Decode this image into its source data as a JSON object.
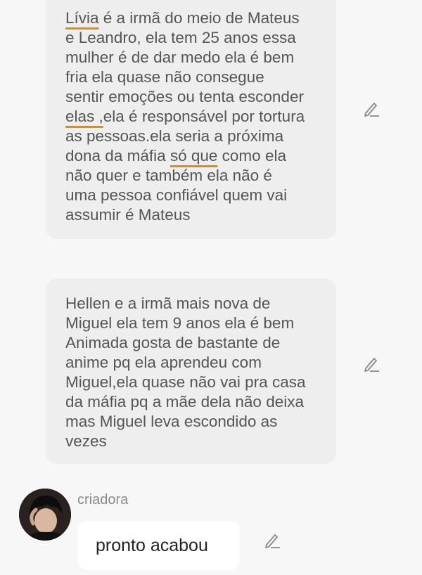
{
  "messages": [
    {
      "lines": [
        [
          {
            "t": "Lívia",
            "u": true
          },
          {
            "t": " é a irmã do meio de Mateus"
          }
        ],
        [
          {
            "t": "e Leandro, ela tem 25 anos essa"
          }
        ],
        [
          {
            "t": "mulher é de dar medo ela é bem"
          }
        ],
        [
          {
            "t": "fria ela quase não consegue"
          }
        ],
        [
          {
            "t": "sentir emoções ou tenta esconder"
          }
        ],
        [
          {
            "t": "elas ,",
            "u": true
          },
          {
            "t": "ela é responsável por tortura"
          }
        ],
        [
          {
            "t": "as pessoas.ela seria a próxima"
          }
        ],
        [
          {
            "t": "dona da máfia "
          },
          {
            "t": "só que",
            "u": true
          },
          {
            "t": " como ela"
          }
        ],
        [
          {
            "t": "não quer e também ela não é"
          }
        ],
        [
          {
            "t": "uma pessoa confiável quem vai"
          }
        ],
        [
          {
            "t": "assumir é Mateus"
          }
        ]
      ]
    },
    {
      "lines": [
        [
          {
            "t": "Hellen e a irmã mais nova de"
          }
        ],
        [
          {
            "t": "Miguel ela tem 9 anos ela é bem"
          }
        ],
        [
          {
            "t": "Animada gosta de bastante de"
          }
        ],
        [
          {
            "t": "anime pq ela aprendeu com"
          }
        ],
        [
          {
            "t": "Miguel,ela quase não vai pra casa"
          }
        ],
        [
          {
            "t": "da máfia pq a mãe dela não deixa"
          }
        ],
        [
          {
            "t": "mas Miguel leva escondido as"
          }
        ],
        [
          {
            "t": "vezes"
          }
        ]
      ]
    }
  ],
  "reply": {
    "sender": "criadora",
    "text": "pronto acabou"
  },
  "icons": {
    "edit": "edit-pencil-icon",
    "avatar": "user-avatar"
  },
  "colors": {
    "bubble": "#eeeeee",
    "text": "#555555",
    "underline": "#e8890c",
    "background": "#f7f7f7"
  }
}
